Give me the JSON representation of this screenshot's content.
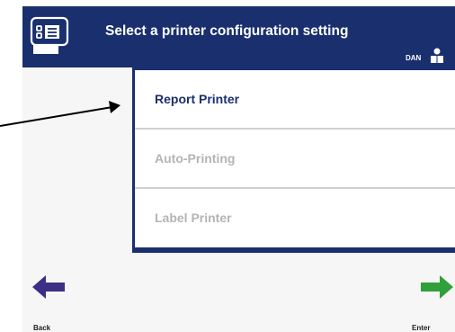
{
  "header": {
    "title": "Select a printer configuration setting",
    "user_name": "DAN",
    "icon": "printer-config-icon",
    "user_icon": "user-icon"
  },
  "menu": {
    "items": [
      {
        "label": "Report Printer",
        "state": "selected"
      },
      {
        "label": "Auto-Printing",
        "state": "disabled"
      },
      {
        "label": "Label Printer",
        "state": "disabled"
      }
    ]
  },
  "nav": {
    "back_label": "Back",
    "enter_label": "Enter",
    "back_icon": "back-arrow-icon",
    "enter_icon": "enter-arrow-icon"
  },
  "colors": {
    "header_bg": "#1a2f6e",
    "selected_text": "#1a2f6e",
    "disabled_text": "#b4b4b4",
    "back_arrow": "#3b2f86",
    "enter_arrow": "#2fa03a"
  }
}
